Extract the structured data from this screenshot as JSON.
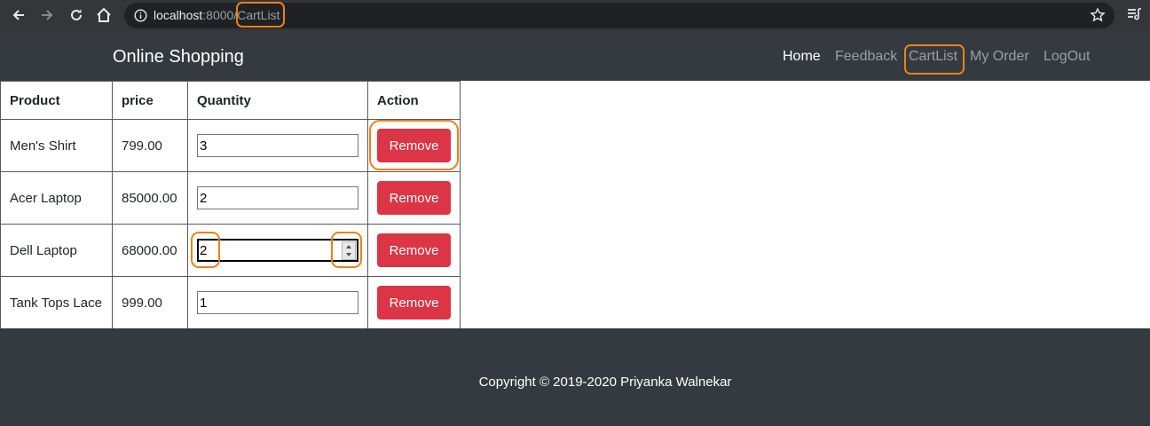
{
  "browser": {
    "url_host": "localhost",
    "url_port": ":8000/",
    "url_path": "CartList"
  },
  "navbar": {
    "brand": "Online Shopping",
    "links": [
      "Home",
      "Feedback",
      "CartList",
      "My Order",
      "LogOut"
    ],
    "active": "Home"
  },
  "cart": {
    "headers": [
      "Product",
      "price",
      "Quantity",
      "Action"
    ],
    "rows": [
      {
        "product": "Men's Shirt",
        "price": "799.00",
        "quantity": "3",
        "action": "Remove"
      },
      {
        "product": "Acer Laptop",
        "price": "85000.00",
        "quantity": "2",
        "action": "Remove"
      },
      {
        "product": "Dell Laptop",
        "price": "68000.00",
        "quantity": "2",
        "action": "Remove"
      },
      {
        "product": "Tank Tops Lace",
        "price": "999.00",
        "quantity": "1",
        "action": "Remove"
      }
    ]
  },
  "footer": {
    "copyright": "Copyright © 2019-2020 Priyanka Walnekar"
  },
  "colors": {
    "navbar_bg": "#343a40",
    "remove_button": "#dc3545",
    "highlight": "#f07f16"
  },
  "icons": [
    "back-icon",
    "forward-icon",
    "reload-icon",
    "home-icon",
    "info-icon",
    "star-icon",
    "reading-list-icon"
  ]
}
